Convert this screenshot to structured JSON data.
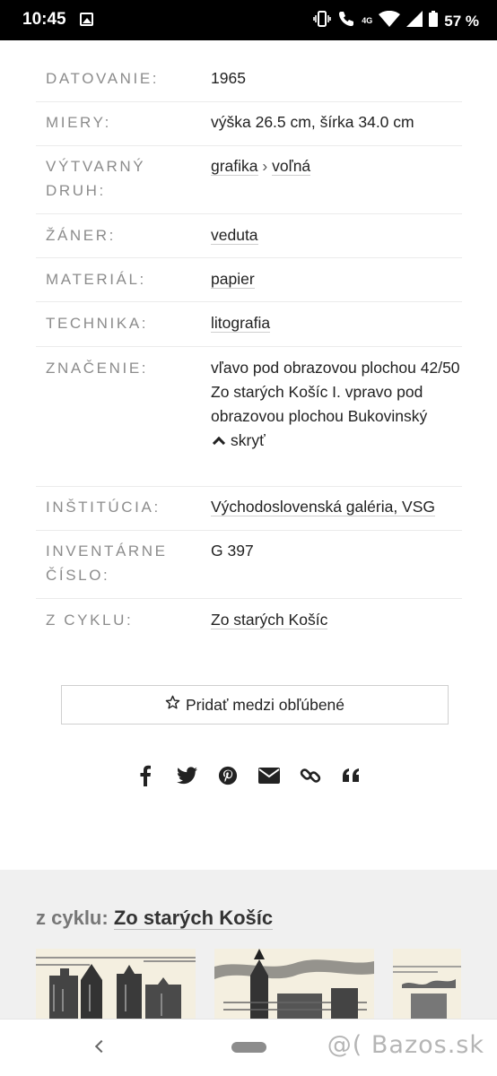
{
  "status_bar": {
    "time": "10:45",
    "network": "4G",
    "battery": "57 %"
  },
  "details": [
    {
      "label": "DATOVANIE:",
      "value": "1965"
    },
    {
      "label": "MIERY:",
      "value": "výška 26.5 cm, šírka 34.0 cm"
    },
    {
      "label": "VÝTVARNÝ DRUH:",
      "links": [
        "grafika",
        "voľná"
      ],
      "separator": "›"
    },
    {
      "label": "ŽÁNER:",
      "link": "veduta"
    },
    {
      "label": "MATERIÁL:",
      "link": "papier"
    },
    {
      "label": "TECHNIKA:",
      "link": "litografia"
    },
    {
      "label": "ZNAČENIE:",
      "value": "vľavo pod obrazovou plochou 42/50 Zo starých Košíc I. vpravo pod obrazovou plochou Bukovinský",
      "toggle": "skryť"
    },
    {
      "label": "INŠTITÚCIA:",
      "link": "Východoslovenská galéria, VSG"
    },
    {
      "label": "INVENTÁRNE ČÍSLO:",
      "value": "G 397"
    },
    {
      "label": "Z CYKLU:",
      "link": "Zo starých Košíc"
    }
  ],
  "favorite_button": {
    "label": "Pridať medzi obľúbené",
    "icon": "star-outline-icon"
  },
  "share_icons": [
    "facebook-icon",
    "twitter-icon",
    "pinterest-icon",
    "email-icon",
    "link-icon",
    "quote-icon"
  ],
  "cycle_section": {
    "prefix": "z cyklu:",
    "link": "Zo starých Košíc"
  },
  "nav_bar": {
    "watermark": "@( Bazos.sk"
  }
}
